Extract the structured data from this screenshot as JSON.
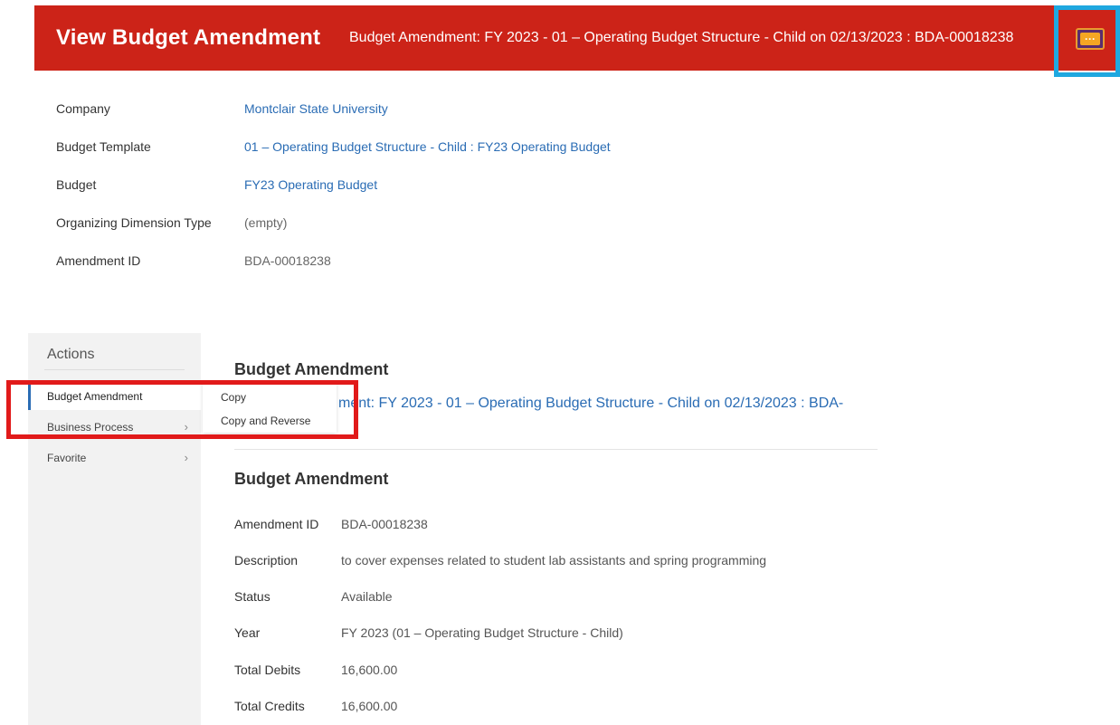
{
  "header": {
    "title": "View Budget Amendment",
    "subtitle": "Budget Amendment: FY 2023 - 01 – Operating Budget Structure - Child on 02/13/2023 : BDA-00018238",
    "more_button": "···"
  },
  "top_fields": [
    {
      "label": "Company",
      "value": "Montclair State University"
    },
    {
      "label": "Budget Template",
      "value": "01 – Operating Budget Structure - Child : FY23 Operating Budget"
    },
    {
      "label": "Budget",
      "value": "FY23 Operating Budget"
    },
    {
      "label": "Organizing Dimension Type",
      "value": "(empty)"
    },
    {
      "label": "Amendment ID",
      "value": "BDA-00018238"
    }
  ],
  "actions": {
    "title": "Actions",
    "items": [
      {
        "label": "Budget Amendment",
        "chevron": "›"
      },
      {
        "label": "Business Process",
        "chevron": "›"
      },
      {
        "label": "Favorite",
        "chevron": "›"
      }
    ],
    "submenu": [
      "Copy",
      "Copy and Reverse"
    ]
  },
  "main": {
    "section1_title": "Budget Amendment",
    "amendment_link_visible": "ment: FY 2023 - 01 – Operating Budget Structure - Child on 02/13/2023 : BDA-",
    "section2_title": "Budget Amendment",
    "details": [
      {
        "label": "Amendment ID",
        "value": "BDA-00018238"
      },
      {
        "label": "Description",
        "value": "to cover expenses related to student lab assistants and spring programming"
      },
      {
        "label": "Status",
        "value": "Available"
      },
      {
        "label": "Year",
        "value": "FY 2023 (01 – Operating Budget Structure - Child)"
      },
      {
        "label": "Total Debits",
        "value": "16,600.00"
      },
      {
        "label": "Total Credits",
        "value": "16,600.00"
      }
    ]
  },
  "colors": {
    "header": "#cc2318",
    "link": "#2a6cb4",
    "highlight_blue": "#1fa8e0",
    "highlight_red": "#e11a1a"
  },
  "icons": {
    "more": "more-actions-icon",
    "chevron": "chevron-right-icon"
  }
}
